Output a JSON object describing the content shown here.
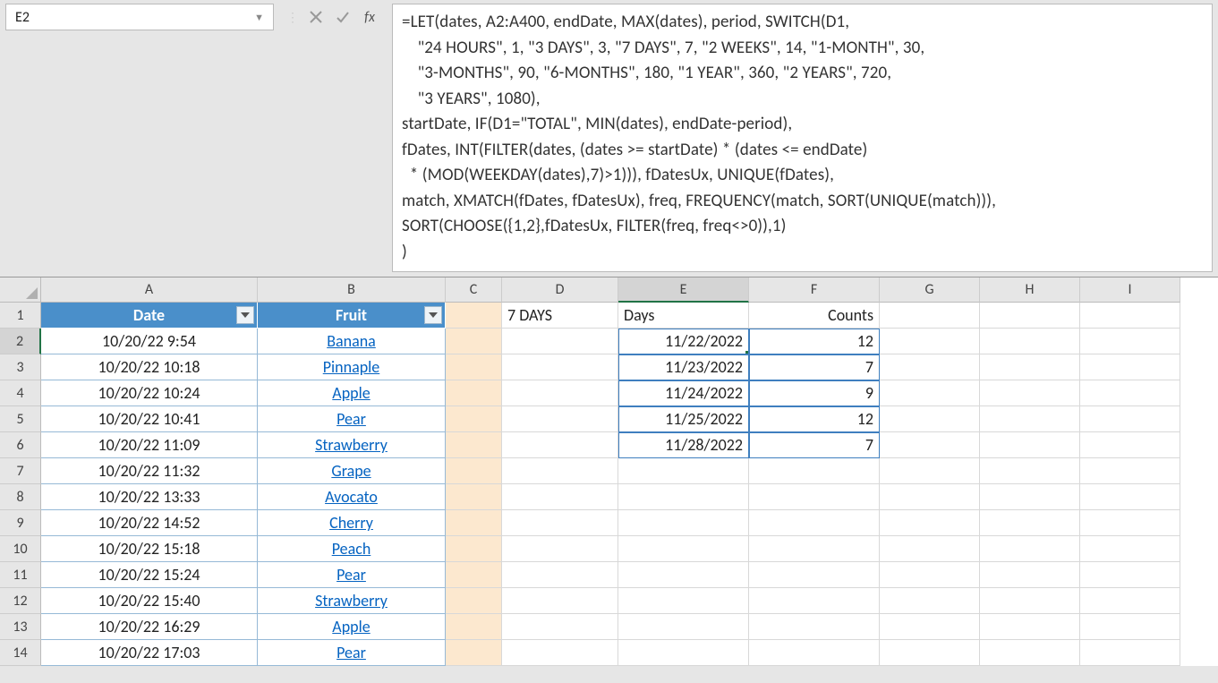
{
  "name_box": "E2",
  "formula": "=LET(dates, A2:A400, endDate, MAX(dates), period, SWITCH(D1,\n    \"24 HOURS\", 1, \"3 DAYS\", 3, \"7 DAYS\", 7, \"2 WEEKS\", 14, \"1-MONTH\", 30,\n    \"3-MONTHS\", 90, \"6-MONTHS\", 180, \"1 YEAR\", 360, \"2 YEARS\", 720,\n    \"3 YEARS\", 1080),\nstartDate, IF(D1=\"TOTAL\", MIN(dates), endDate-period),\nfDates, INT(FILTER(dates, (dates >= startDate) * (dates <= endDate)\n  * (MOD(WEEKDAY(dates),7)>1))), fDatesUx, UNIQUE(fDates),\nmatch, XMATCH(fDates, fDatesUx), freq, FREQUENCY(match, SORT(UNIQUE(match))),\nSORT(CHOOSE({1,2},fDatesUx, FILTER(freq, freq<>0)),1)\n)",
  "columns": [
    "A",
    "B",
    "C",
    "D",
    "E",
    "F",
    "G",
    "H",
    "I"
  ],
  "table": {
    "headers": {
      "date": "Date",
      "fruit": "Fruit"
    },
    "rows": [
      {
        "date": "10/20/22 9:54",
        "fruit": "Banana"
      },
      {
        "date": "10/20/22 10:18",
        "fruit": "Pinnaple"
      },
      {
        "date": "10/20/22 10:24",
        "fruit": "Apple"
      },
      {
        "date": "10/20/22 10:41",
        "fruit": "Pear"
      },
      {
        "date": "10/20/22 11:09",
        "fruit": "Strawberry"
      },
      {
        "date": "10/20/22 11:32",
        "fruit": "Grape"
      },
      {
        "date": "10/20/22 13:33",
        "fruit": "Avocato"
      },
      {
        "date": "10/20/22 14:52",
        "fruit": "Cherry"
      },
      {
        "date": "10/20/22 15:18",
        "fruit": "Peach"
      },
      {
        "date": "10/20/22 15:24",
        "fruit": "Pear"
      },
      {
        "date": "10/20/22 15:40",
        "fruit": "Strawberry"
      },
      {
        "date": "10/20/22 16:29",
        "fruit": "Apple"
      },
      {
        "date": "10/20/22 17:03",
        "fruit": "Pear"
      }
    ]
  },
  "d1": "7 DAYS",
  "e1": "Days",
  "f1": "Counts",
  "results": [
    {
      "day": "11/22/2022",
      "count": "12"
    },
    {
      "day": "11/23/2022",
      "count": "7"
    },
    {
      "day": "11/24/2022",
      "count": "9"
    },
    {
      "day": "11/25/2022",
      "count": "12"
    },
    {
      "day": "11/28/2022",
      "count": "7"
    }
  ],
  "row_numbers": [
    "1",
    "2",
    "3",
    "4",
    "5",
    "6",
    "7",
    "8",
    "9",
    "10",
    "11",
    "12",
    "13",
    "14"
  ]
}
